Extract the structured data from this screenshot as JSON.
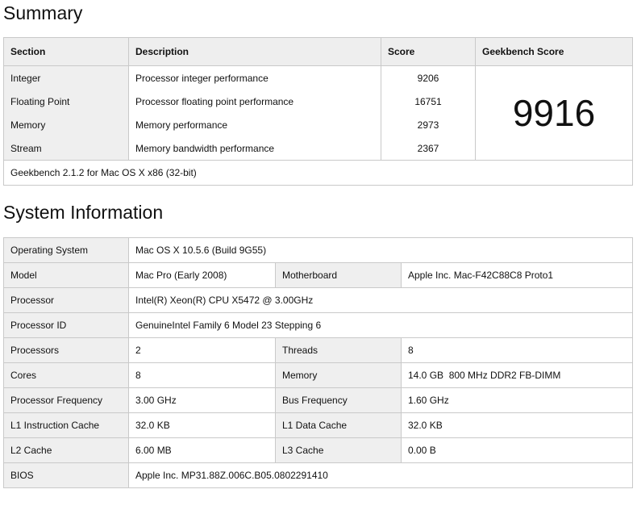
{
  "summary": {
    "heading": "Summary",
    "columns": [
      "Section",
      "Description",
      "Score",
      "Geekbench Score"
    ],
    "rows": [
      {
        "section": "Integer",
        "description": "Processor integer performance",
        "score": "9206"
      },
      {
        "section": "Floating Point",
        "description": "Processor floating point performance",
        "score": "16751"
      },
      {
        "section": "Memory",
        "description": "Memory performance",
        "score": "2973"
      },
      {
        "section": "Stream",
        "description": "Memory bandwidth performance",
        "score": "2367"
      }
    ],
    "geekbench_score": "9916",
    "footer": "Geekbench 2.1.2 for Mac OS X x86 (32-bit)"
  },
  "system": {
    "heading": "System Information",
    "os_label": "Operating System",
    "os_value": "Mac OS X 10.5.6 (Build 9G55)",
    "model_label": "Model",
    "model_value": "Mac Pro (Early 2008)",
    "motherboard_label": "Motherboard",
    "motherboard_value": "Apple Inc. Mac-F42C88C8 Proto1",
    "processor_label": "Processor",
    "processor_value": "Intel(R) Xeon(R) CPU X5472 @ 3.00GHz",
    "processor_id_label": "Processor ID",
    "processor_id_value": "GenuineIntel Family 6 Model 23 Stepping 6",
    "processors_label": "Processors",
    "processors_value": "2",
    "threads_label": "Threads",
    "threads_value": "8",
    "cores_label": "Cores",
    "cores_value": "8",
    "memory_label": "Memory",
    "memory_value": "14.0 GB  800 MHz DDR2 FB-DIMM",
    "proc_freq_label": "Processor Frequency",
    "proc_freq_value": "3.00 GHz",
    "bus_freq_label": "Bus Frequency",
    "bus_freq_value": "1.60 GHz",
    "l1i_label": "L1 Instruction Cache",
    "l1i_value": "32.0 KB",
    "l1d_label": "L1 Data Cache",
    "l1d_value": "32.0 KB",
    "l2_label": "L2 Cache",
    "l2_value": "6.00 MB",
    "l3_label": "L3 Cache",
    "l3_value": "0.00 B",
    "bios_label": "BIOS",
    "bios_value": "Apple Inc. MP31.88Z.006C.B05.0802291410"
  }
}
